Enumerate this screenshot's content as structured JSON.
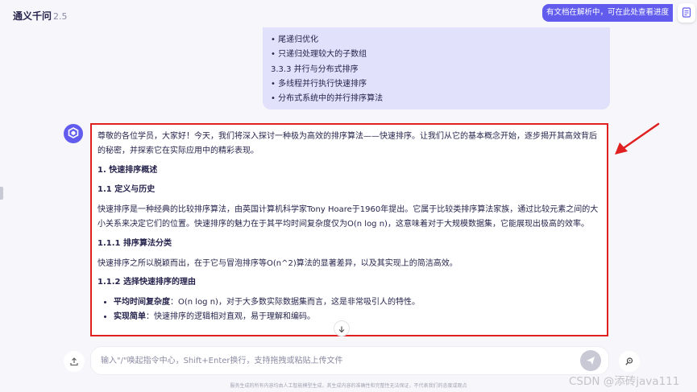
{
  "app": {
    "title": "通义千问",
    "version": "2.5"
  },
  "header": {
    "parse_status": "有文档在解析中，可在此处查看进度"
  },
  "user_message": {
    "lines": [
      "• 尾递归优化",
      "• 只递归处理较大的子数组",
      "3.3.3 并行与分布式排序",
      "• 多线程并行执行快速排序",
      "• 分布式系统中的并行排序算法"
    ]
  },
  "answer": {
    "intro": "尊敬的各位学员，大家好！今天，我们将深入探讨一种极为高效的排序算法——快速排序。让我们从它的基本概念开始，逐步揭开其高效背后的秘密，并探索它在实际应用中的精彩表现。",
    "h1": "1. 快速排序概述",
    "h1_1": "1.1 定义与历史",
    "p1": "快速排序是一种经典的比较排序算法，由英国计算机科学家Tony Hoare于1960年提出。它属于比较类排序算法家族，通过比较元素之间的大小关系来决定它们的位置。快速排序的魅力在于其平均时间复杂度仅为O(n log n)，这意味着对于大规模数据集，它能展现出极高的效率。",
    "h1_1_1": "1.1.1 排序算法分类",
    "p2": "快速排序之所以脱颖而出，在于它与冒泡排序等O(n^2)算法的显著差异，以及其实现上的简洁高效。",
    "h1_1_2": "1.1.2 选择快速排序的理由",
    "bullets": [
      {
        "bold": "平均时间复杂度",
        "text": "：O(n log n)，对于大多数实际数据集而言，这是非常吸引人的特性。"
      },
      {
        "bold": "实现简单",
        "text": "：快速排序的逻辑相对直观，易于理解和编码。"
      }
    ]
  },
  "input": {
    "placeholder": "输入\"/\"唤起指令中心，Shift+Enter换行，支持拖拽或粘贴上传文件"
  },
  "footer": {
    "disclaimer": "服务生成的所有内容均由人工智能模型生成，其生成内容的准确性和完整性无法保证，不代表我们的态度或观点",
    "watermark": "CSDN @添砖java111"
  },
  "colors": {
    "accent": "#615ced",
    "highlight_border": "#e02020",
    "annotation_arrow": "#e02020"
  }
}
